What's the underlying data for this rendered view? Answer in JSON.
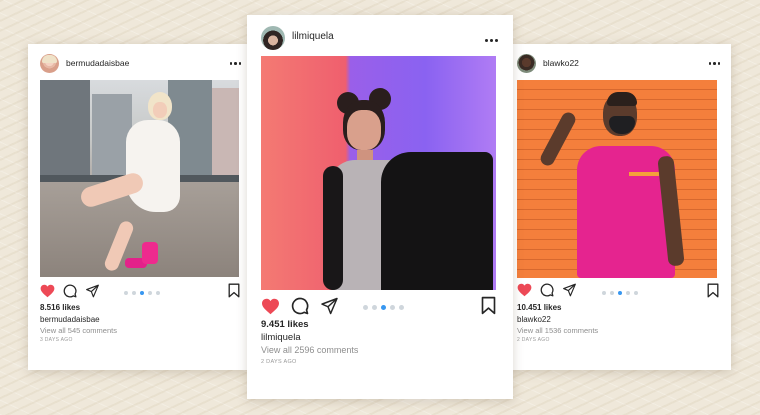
{
  "colors": {
    "like_red": "#ed4956",
    "dot_active": "#3897f0",
    "dot_inactive": "#cfd6dc",
    "muted_text": "#8e8e8e"
  },
  "posts": [
    {
      "username": "bermudadaisbae",
      "likes": "8.516 likes",
      "caption_user": "bermudadaisbae",
      "comments": "View all 545 comments",
      "time": "3 DAYS AGO",
      "liked": true,
      "carousel_dots": 5,
      "carousel_active": 2
    },
    {
      "username": "lilmiquela",
      "likes": "9.451 likes",
      "caption_user": "lilmiquela",
      "comments": "View all 2596 comments",
      "time": "2 DAYS AGO",
      "liked": true,
      "carousel_dots": 5,
      "carousel_active": 2
    },
    {
      "username": "blawko22",
      "likes": "10.451 likes",
      "caption_user": "blawko22",
      "comments": "View all 1536 comments",
      "time": "2 DAYS AGO",
      "liked": true,
      "carousel_dots": 5,
      "carousel_active": 2
    }
  ],
  "icons": [
    "heart-icon",
    "comment-icon",
    "share-icon",
    "bookmark-icon",
    "more-icon"
  ]
}
